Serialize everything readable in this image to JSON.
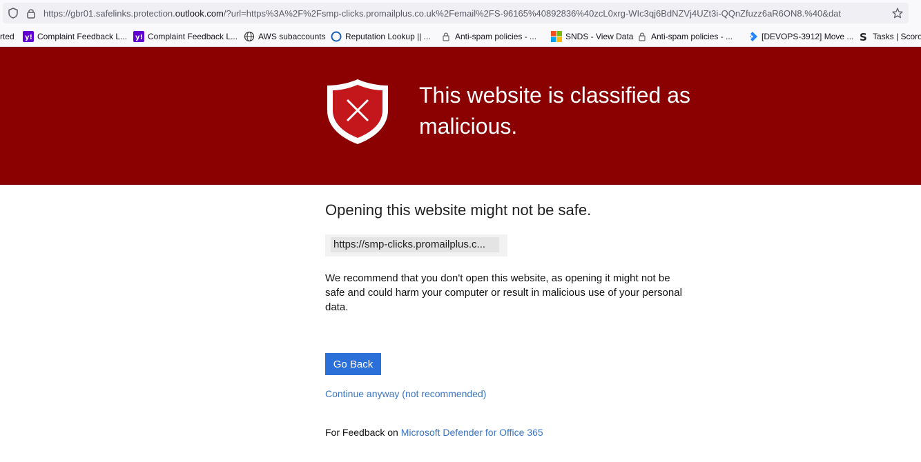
{
  "browser": {
    "url_prefix": "https://gbr01.safelinks.protection.",
    "url_domain": "outlook.com",
    "url_suffix": "/?url=https%3A%2F%2Fsmp-clicks.promailplus.co.uk%2Femail%2FS-96165%40892836%40zcL0xrg-WIc3qj6BdNZVj4UZt3i-QQnZfuzz6aR6ON8.%40&dat",
    "icons": [
      "shield-icon",
      "lock-icon",
      "bookmark-star-icon"
    ]
  },
  "bookmarks": [
    {
      "label": "rted",
      "icon": ""
    },
    {
      "label": "Complaint Feedback L...",
      "icon": "yahoo-icon"
    },
    {
      "label": "Complaint Feedback L...",
      "icon": "yahoo-icon"
    },
    {
      "label": "AWS subaccounts",
      "icon": "globe-icon"
    },
    {
      "label": "Reputation Lookup || ...",
      "icon": "reputation-icon"
    },
    {
      "label": "Anti-spam policies - ...",
      "icon": "lock-icon"
    },
    {
      "label": "SNDS - View Data",
      "icon": "microsoft-icon"
    },
    {
      "label": "Anti-spam policies - ...",
      "icon": "lock-icon"
    },
    {
      "label": "[DEVOPS-3912] Move ...",
      "icon": "jira-icon"
    },
    {
      "label": "Tasks | Scoro",
      "icon": "scoro-icon"
    }
  ],
  "banner": {
    "title": "This website is classified as malicious.",
    "background": "#8b0000",
    "icon": "shield-x-icon"
  },
  "content": {
    "heading": "Opening this website might not be safe.",
    "blocked_url": "https://smp-clicks.promailplus.c...",
    "warning": "We recommend that you don't open this website, as opening it might not be safe and could harm your computer or result in malicious use of your personal data.",
    "go_back_label": "Go Back",
    "continue_label": "Continue anyway (not recommended)",
    "feedback_prefix": "For Feedback on ",
    "feedback_link": "Microsoft Defender for Office 365"
  },
  "colors": {
    "accent_button": "#2b6fd8",
    "link": "#3a75c4"
  }
}
